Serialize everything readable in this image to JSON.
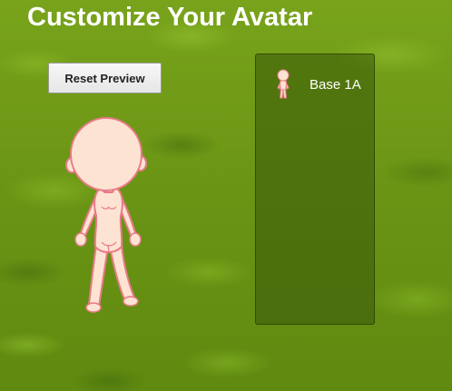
{
  "page": {
    "title": "Customize Your Avatar"
  },
  "controls": {
    "reset_label": "Reset Preview"
  },
  "items_panel": {
    "items": [
      {
        "label": "Base 1A",
        "icon": "avatar-base-thumbnail"
      }
    ]
  },
  "colors": {
    "background": "#6f9a17",
    "title_text": "#ffffff",
    "panel_background": "#375508",
    "skin": "#fde3d2",
    "skin_outline": "#e87a88"
  }
}
